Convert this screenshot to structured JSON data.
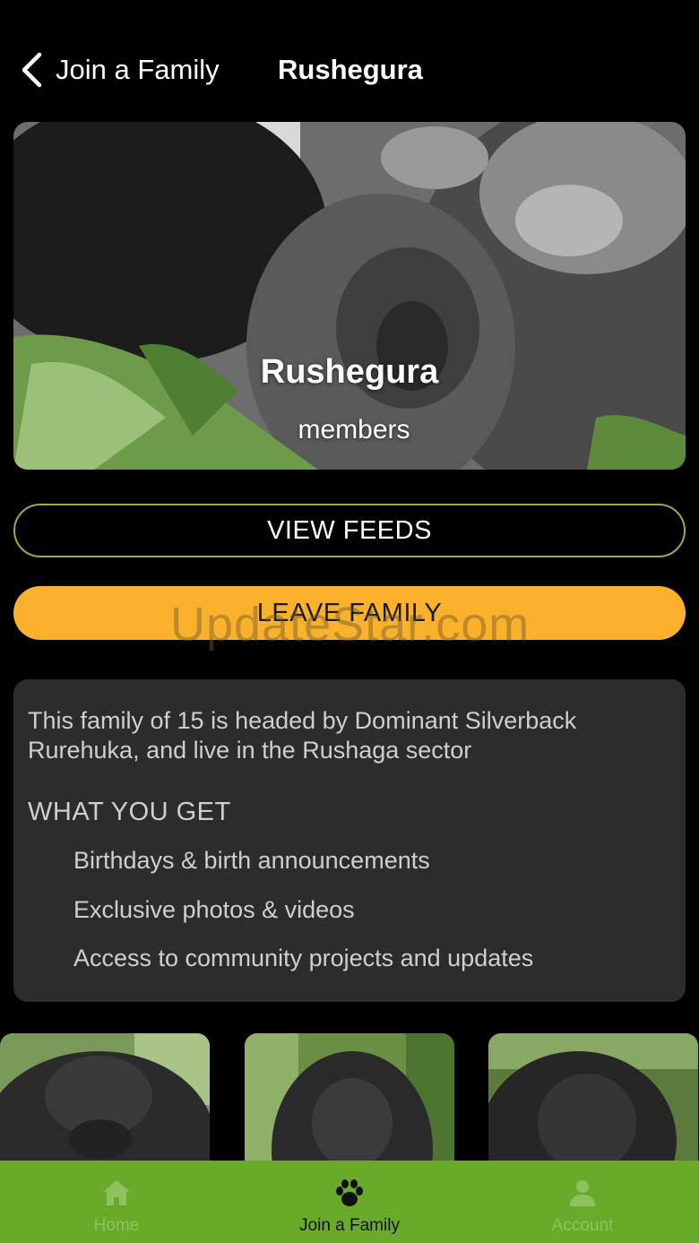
{
  "header": {
    "back_label": "Join a Family",
    "title": "Rushegura"
  },
  "hero": {
    "name": "Rushegura",
    "members_label": "members"
  },
  "actions": {
    "view_feeds": "VIEW FEEDS",
    "leave_family": "LEAVE FAMILY"
  },
  "watermark": "UpdateStar.com",
  "info": {
    "description": "This family of 15 is headed by Dominant Silverback Rurehuka, and live in the Rushaga sector",
    "heading": "WHAT YOU GET",
    "benefits": [
      "Birthdays & birth announcements",
      "Exclusive photos & videos",
      "Access to community projects and updates"
    ]
  },
  "tabbar": {
    "tabs": [
      {
        "label": "Home",
        "icon": "home-icon",
        "active": false
      },
      {
        "label": "Join a Family",
        "icon": "paw-icon",
        "active": true
      },
      {
        "label": "Account",
        "icon": "person-icon",
        "active": false
      }
    ]
  },
  "colors": {
    "accent_green": "#6aaa2a",
    "leave_orange": "#fbb12c",
    "card_bg": "#2c2c2e"
  }
}
